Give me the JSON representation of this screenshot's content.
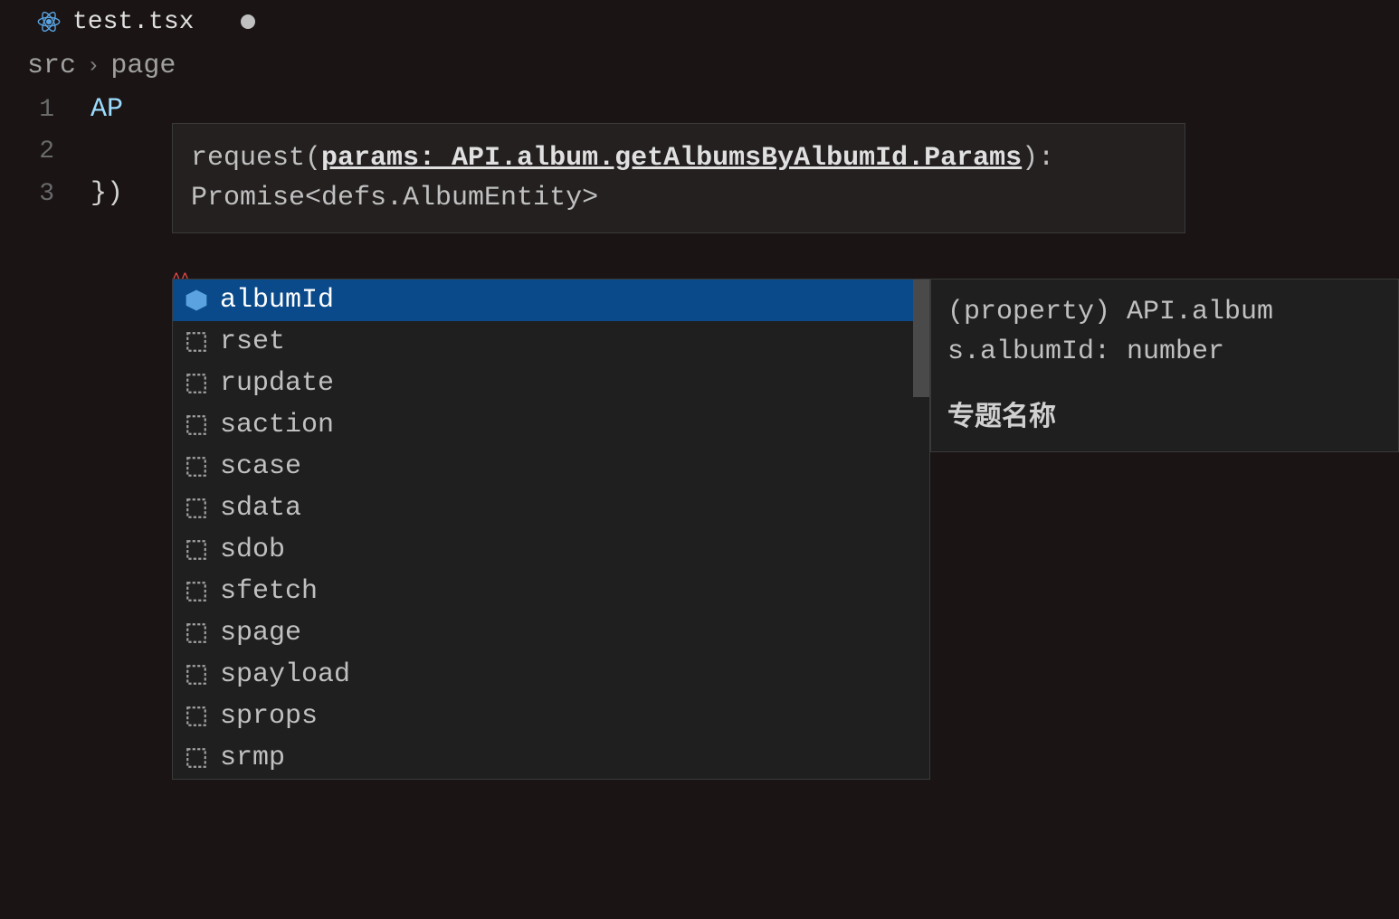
{
  "tab": {
    "filename": "test.tsx"
  },
  "breadcrumb": {
    "parts": [
      "src",
      "page"
    ]
  },
  "code": {
    "lines": [
      {
        "num": "1",
        "text": "AP"
      },
      {
        "num": "2",
        "text": ""
      },
      {
        "num": "3",
        "text": "})"
      }
    ]
  },
  "signature": {
    "func": "request(",
    "active_param": "params: API.album.getAlbumsByAlbumId.Params",
    "after": "):",
    "return_line": "Promise<defs.AlbumEntity>"
  },
  "completion": {
    "items": [
      {
        "label": "albumId",
        "kind": "field",
        "selected": true
      },
      {
        "label": "rset",
        "kind": "snippet",
        "selected": false
      },
      {
        "label": "rupdate",
        "kind": "snippet",
        "selected": false
      },
      {
        "label": "saction",
        "kind": "snippet",
        "selected": false
      },
      {
        "label": "scase",
        "kind": "snippet",
        "selected": false
      },
      {
        "label": "sdata",
        "kind": "snippet",
        "selected": false
      },
      {
        "label": "sdob",
        "kind": "snippet",
        "selected": false
      },
      {
        "label": "sfetch",
        "kind": "snippet",
        "selected": false
      },
      {
        "label": "spage",
        "kind": "snippet",
        "selected": false
      },
      {
        "label": "spayload",
        "kind": "snippet",
        "selected": false
      },
      {
        "label": "sprops",
        "kind": "snippet",
        "selected": false
      },
      {
        "label": "srmp",
        "kind": "snippet",
        "selected": false
      }
    ]
  },
  "detail": {
    "line1": "(property) API.album",
    "line2": "s.albumId: number",
    "desc": "专题名称"
  }
}
